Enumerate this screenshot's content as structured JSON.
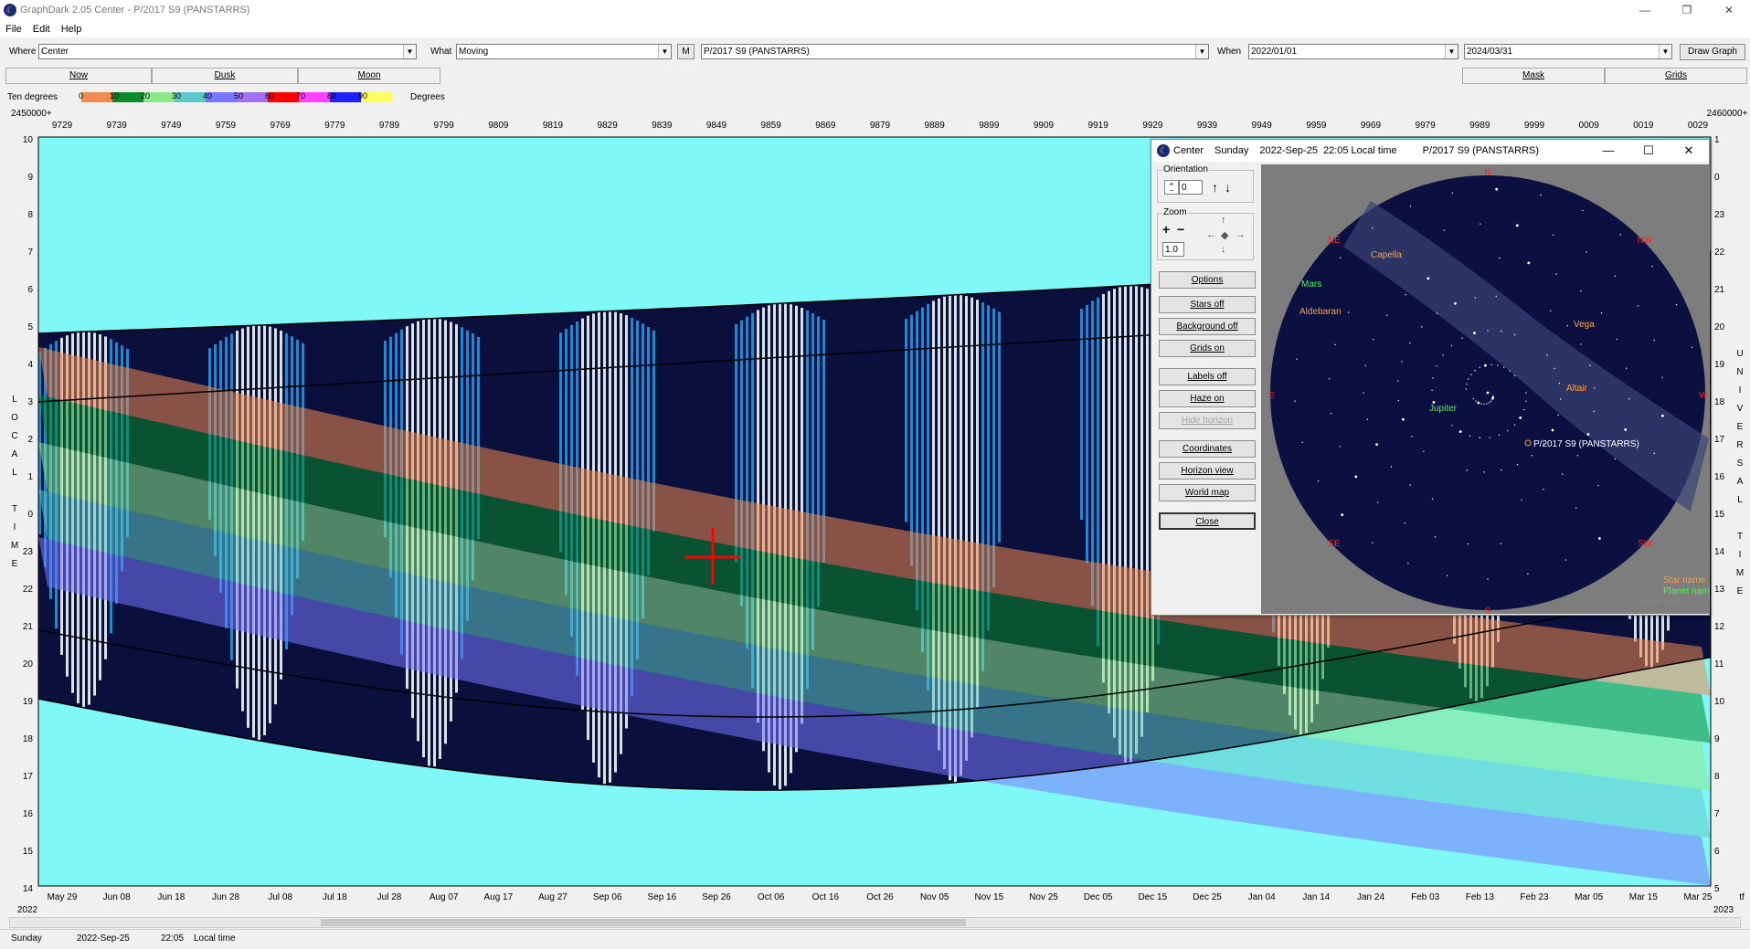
{
  "window": {
    "title": "GraphDark 2.05  Center  -  P/2017 S9 (PANSTARRS)",
    "minimize": "—",
    "maximize": "❐",
    "close": "✕"
  },
  "menu": [
    "File",
    "Edit",
    "Help"
  ],
  "toolbar": {
    "where_label": "Where",
    "where_value": "Center",
    "what_label": "What",
    "what_value": "Moving",
    "m_button": "M",
    "object_value": "P/2017 S9 (PANSTARRS)",
    "when_label": "When",
    "start_date": "2022/01/01",
    "end_date": "2024/03/31",
    "draw_button": "Draw Graph"
  },
  "tabs": {
    "now": "Now",
    "dusk": "Dusk",
    "moon": "Moon",
    "mask": "Mask",
    "grids": "Grids"
  },
  "legend": {
    "title": "Ten degrees",
    "unit": "Degrees",
    "ticks": [
      "0",
      "10",
      "20",
      "30",
      "40",
      "50",
      "60",
      "70",
      "80",
      "90"
    ],
    "colors": [
      "#f08a50",
      "#0a8a2a",
      "#8ce88c",
      "#5ec8c8",
      "#7878ff",
      "#a070f0",
      "#ff0000",
      "#ff40ff",
      "#2020ff",
      "#ffff60"
    ]
  },
  "chart_data": {
    "type": "heatmap",
    "jd_prefix_left": "2450000+",
    "jd_prefix_right": "2460000+",
    "jd_ticks": [
      "9729",
      "9739",
      "9749",
      "9759",
      "9769",
      "9779",
      "9789",
      "9799",
      "9809",
      "9819",
      "9829",
      "9839",
      "9849",
      "9859",
      "9869",
      "9879",
      "9889",
      "9899",
      "9909",
      "9919",
      "9929",
      "9939",
      "9949",
      "9959",
      "9969",
      "9979",
      "9989",
      "9999",
      "0009",
      "0019",
      "0029"
    ],
    "date_ticks": [
      "May 29",
      "Jun 08",
      "Jun 18",
      "Jun 28",
      "Jul 08",
      "Jul 18",
      "Jul 28",
      "Aug 07",
      "Aug 17",
      "Aug 27",
      "Sep 06",
      "Sep 16",
      "Sep 26",
      "Oct 06",
      "Oct 16",
      "Oct 26",
      "Nov 05",
      "Nov 15",
      "Nov 25",
      "Dec 05",
      "Dec 15",
      "Dec 25",
      "Jan 04",
      "Jan 14",
      "Jan 24",
      "Feb 03",
      "Feb 13",
      "Feb 23",
      "Mar 05",
      "Mar 15",
      "Mar 25"
    ],
    "year_left": "2022",
    "year_right": "2023",
    "corner_right": "tf",
    "left_axis_ticks": [
      "10",
      "9",
      "8",
      "7",
      "6",
      "5",
      "4",
      "3",
      "2",
      "1",
      "0",
      "23",
      "22",
      "21",
      "20",
      "19",
      "18",
      "17",
      "16",
      "15",
      "14"
    ],
    "right_axis_ticks": [
      "1",
      "0",
      "23",
      "22",
      "21",
      "20",
      "19",
      "18",
      "17",
      "16",
      "15",
      "14",
      "13",
      "12",
      "11",
      "10",
      "9",
      "8",
      "7",
      "6",
      "5"
    ],
    "left_axis_label": [
      "L",
      "O",
      "C",
      "A",
      "L",
      "",
      "T",
      "I",
      "M",
      "E"
    ],
    "right_axis_label": [
      "U",
      "N",
      "I",
      "V",
      "E",
      "R",
      "S",
      "A",
      "L",
      "",
      "T",
      "I",
      "M",
      "E"
    ],
    "cursor_date": "Sep 26"
  },
  "popup": {
    "title": "Center",
    "day": "Sunday",
    "date": "2022-Sep-25",
    "time": "22:05 Local time",
    "object": "P/2017 S9 (PANSTARRS)",
    "orientation_label": "Orientation",
    "orientation_value": "0",
    "zoom_label": "Zoom",
    "zoom_value": "1.0",
    "buttons": {
      "options": "Options",
      "stars_off": "Stars off",
      "background_off": "Background off",
      "grids_on": "Grids on",
      "labels_off": "Labels off",
      "haze_on": "Haze on",
      "hide_horizon": "Hide horizon",
      "coordinates": "Coordinates",
      "horizon_view": "Horizon view",
      "world_map": "World map",
      "close": "Close"
    },
    "sky": {
      "compass": {
        "n": "N",
        "ne": "NE",
        "nw": "NW",
        "e": "E",
        "w": "W",
        "se": "SE",
        "sw": "SW",
        "s": "S"
      },
      "stars": [
        "Capella",
        "Aldebaran",
        "Vega",
        "Altair"
      ],
      "planets": [
        "Mars",
        "Jupiter"
      ],
      "target": "P/2017 S9 (PANSTARRS)",
      "legend_star": "Star name",
      "legend_planet": "Planet name",
      "legend_milky": "Milky way"
    }
  },
  "status": {
    "day": "Sunday",
    "date": "2022-Sep-25",
    "time": "22:05",
    "zone": "Local time"
  }
}
